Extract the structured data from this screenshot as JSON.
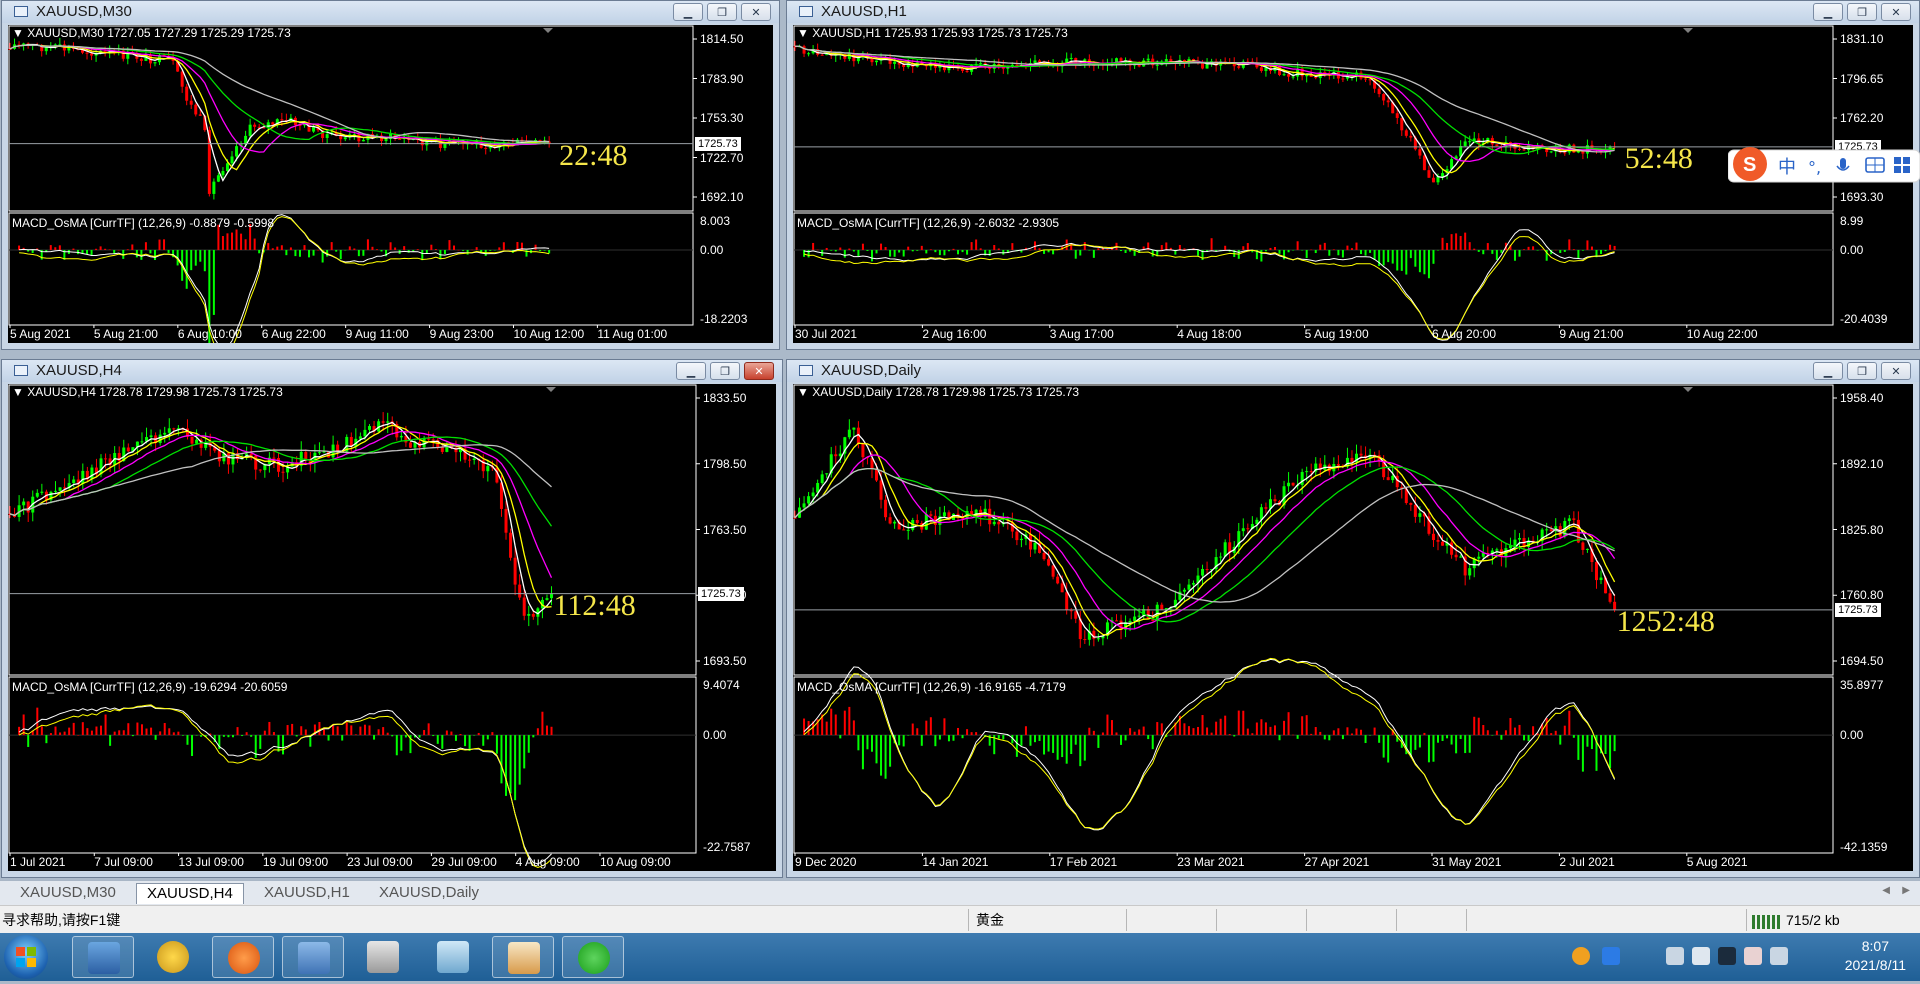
{
  "windows": [
    {
      "id": "m30",
      "title": "XAUUSD,M30",
      "info": "XAUUSD,M30  1727.05 1727.29 1725.29 1725.73",
      "macd_info": "MACD_OsMA [CurrTF] (12,26,9) -0.8879 -0.5998",
      "timer": "22:48",
      "bid_label": "1725.73",
      "prices": [
        "1814.50",
        "1783.90",
        "1753.30",
        "1722.70",
        "1692.10"
      ],
      "macd_scale": [
        "8.003",
        "0.00",
        "-18.2203"
      ],
      "x_labels": [
        "5 Aug 2021",
        "5 Aug 21:00",
        "6 Aug 10:00",
        "6 Aug 22:00",
        "9 Aug 11:00",
        "9 Aug 23:00",
        "10 Aug 12:00",
        "11 Aug 01:00"
      ],
      "close_active": false,
      "shape": "m30"
    },
    {
      "id": "h1",
      "title": "XAUUSD,H1",
      "info": "XAUUSD,H1  1725.93 1725.93 1725.73 1725.73",
      "macd_info": "MACD_OsMA [CurrTF] (12,26,9) -2.6032 -2.9305",
      "timer": "52:48",
      "bid_label": "1725.73",
      "prices": [
        "1831.10",
        "1796.65",
        "1762.20",
        "1727.75",
        "1693.30"
      ],
      "macd_scale": [
        "8.99",
        "0.00",
        "-20.4039"
      ],
      "x_labels": [
        "30 Jul 2021",
        "2 Aug 16:00",
        "3 Aug 17:00",
        "4 Aug 18:00",
        "5 Aug 19:00",
        "6 Aug 20:00",
        "9 Aug 21:00",
        "10 Aug 22:00"
      ],
      "close_active": false,
      "shape": "h1"
    },
    {
      "id": "h4",
      "title": "XAUUSD,H4",
      "info": "XAUUSD,H4  1728.78 1729.98 1725.73 1725.73",
      "macd_info": "MACD_OsMA [CurrTF] (12,26,9) -19.6294 -20.6059",
      "timer": "112:48",
      "bid_label": "1725.73",
      "prices": [
        "1833.50",
        "1798.50",
        "1763.50",
        "1728.50",
        "1693.50"
      ],
      "macd_scale": [
        "9.4074",
        "0.00",
        "-22.7587"
      ],
      "x_labels": [
        "1 Jul 2021",
        "7 Jul 09:00",
        "13 Jul 09:00",
        "19 Jul 09:00",
        "23 Jul 09:00",
        "29 Jul 09:00",
        "4 Aug 09:00",
        "10 Aug 09:00"
      ],
      "close_active": true,
      "shape": "h4"
    },
    {
      "id": "daily",
      "title": "XAUUSD,Daily",
      "info": "XAUUSD,Daily  1728.78 1729.98 1725.73 1725.73",
      "macd_info": "MACD_OsMA [CurrTF] (12,26,9) -16.9165 -4.7179",
      "timer": "1252:48",
      "bid_label": "1725.73",
      "prices": [
        "1958.40",
        "1892.10",
        "1825.80",
        "1760.80",
        "1694.50"
      ],
      "macd_scale": [
        "35.8977",
        "0.00",
        "-42.1359"
      ],
      "x_labels": [
        "9 Dec 2020",
        "14 Jan 2021",
        "17 Feb 2021",
        "23 Mar 2021",
        "27 Apr 2021",
        "31 May 2021",
        "2 Jul 2021",
        "5 Aug 2021"
      ],
      "close_active": false,
      "shape": "daily"
    }
  ],
  "tabs": [
    "XAUUSD,M30",
    "XAUUSD,H4",
    "XAUUSD,H1",
    "XAUUSD,Daily"
  ],
  "active_tab": "XAUUSD,H4",
  "status": {
    "help": "寻求帮助,请按F1键",
    "profile": "黄金",
    "traffic": "715/2 kb"
  },
  "ime": {
    "lang": "中",
    "punct": "°,"
  },
  "clock": {
    "time": "8:07",
    "date": "2021/8/11"
  },
  "colors": {
    "chart_bg": "#000000",
    "bull": "#00ff00",
    "bear": "#ff0000",
    "ma_fast": "#ffffff",
    "ma_yellow": "#ffff00",
    "ma_magenta": "#ff00ff",
    "ma_green": "#00e000",
    "ma_silver": "#c0c0c0",
    "timer": "#f5e64a"
  }
}
